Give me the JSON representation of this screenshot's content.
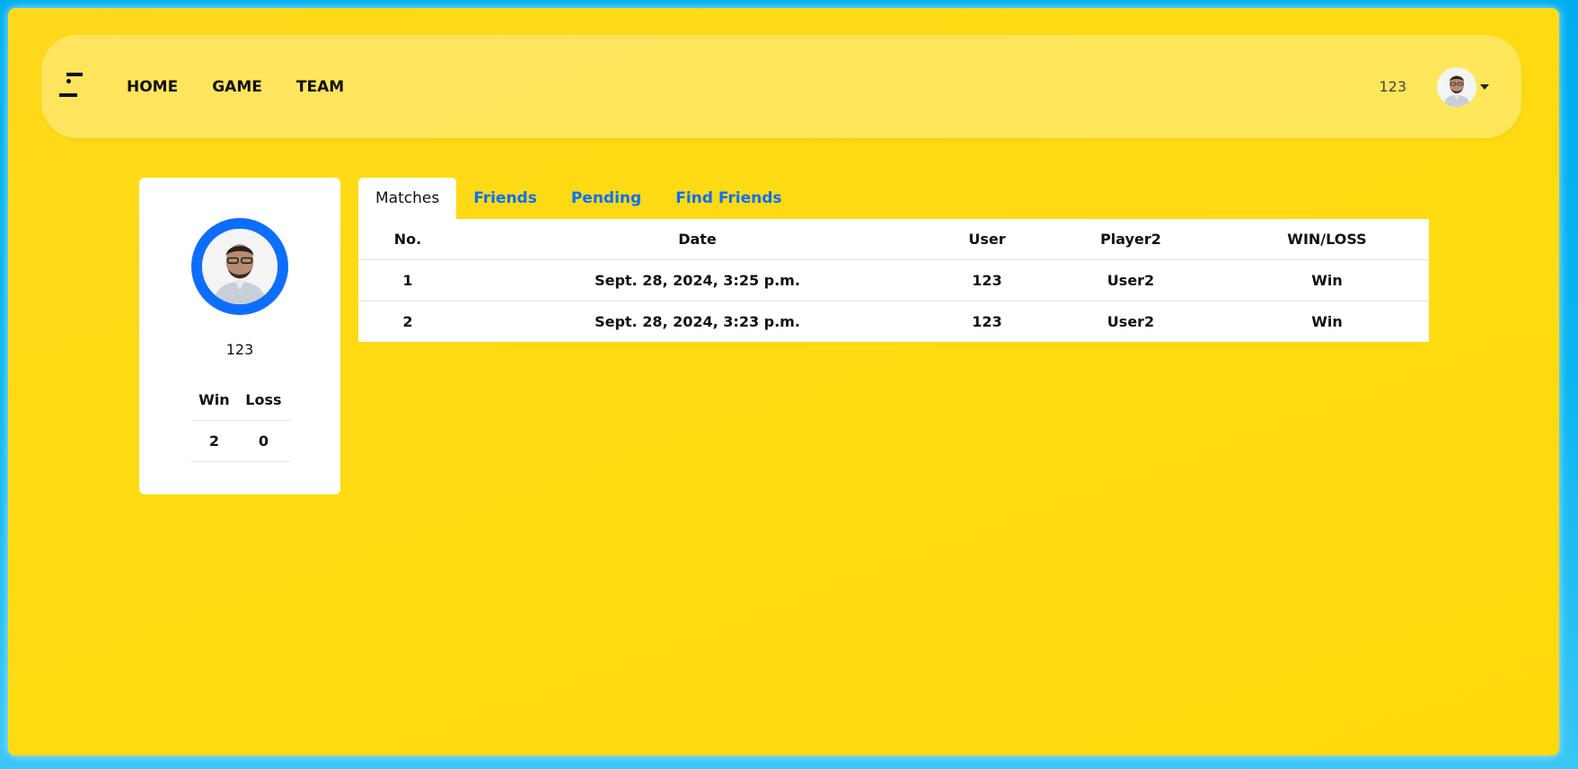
{
  "nav": {
    "links": [
      "HOME",
      "GAME",
      "TEAM"
    ],
    "username": "123"
  },
  "profile": {
    "name": "123",
    "stats_headers": [
      "Win",
      "Loss"
    ],
    "wins": "2",
    "losses": "0"
  },
  "tabs": [
    "Matches",
    "Friends",
    "Pending",
    "Find Friends"
  ],
  "matches": {
    "headers": [
      "No.",
      "Date",
      "User",
      "Player2",
      "WIN/LOSS"
    ],
    "rows": [
      [
        "1",
        "Sept. 28, 2024, 3:25 p.m.",
        "123",
        "User2",
        "Win"
      ],
      [
        "2",
        "Sept. 28, 2024, 3:23 p.m.",
        "123",
        "User2",
        "Win"
      ]
    ]
  },
  "colors": {
    "background": "#00aeef",
    "frame": "#fedb10",
    "accent": "#0d6efd"
  }
}
